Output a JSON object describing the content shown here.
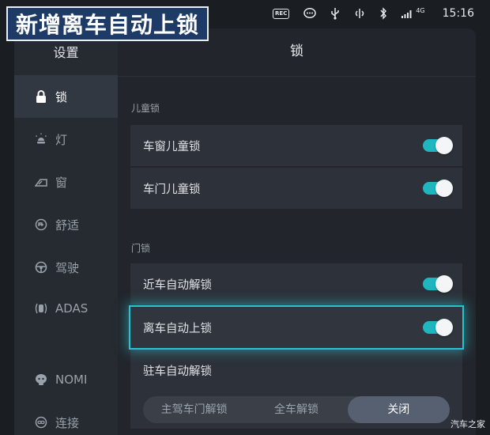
{
  "caption": "新增离车自动上锁",
  "status_bar": {
    "rec_label": "REC",
    "network": "4G",
    "time": "15:16"
  },
  "sidebar": {
    "title": "设置",
    "items": [
      {
        "label": "锁",
        "icon": "lock-icon",
        "active": true
      },
      {
        "label": "灯",
        "icon": "light-icon",
        "active": false
      },
      {
        "label": "窗",
        "icon": "window-icon",
        "active": false
      },
      {
        "label": "舒适",
        "icon": "comfort-icon",
        "active": false
      },
      {
        "label": "驾驶",
        "icon": "steering-wheel-icon",
        "active": false
      },
      {
        "label": "ADAS",
        "icon": "adas-icon",
        "active": false
      },
      {
        "label": "NOMI",
        "icon": "nomi-icon",
        "active": false
      },
      {
        "label": "连接",
        "icon": "link-icon",
        "active": false
      }
    ]
  },
  "content": {
    "title": "锁",
    "child_lock_section": "儿童锁",
    "window_child_lock": {
      "label": "车窗儿童锁",
      "enabled": true
    },
    "door_child_lock": {
      "label": "车门儿童锁",
      "enabled": true
    },
    "door_lock_section": "门锁",
    "approach_unlock": {
      "label": "近车自动解锁",
      "enabled": true
    },
    "leave_lock": {
      "label": "离车自动上锁",
      "enabled": true
    },
    "park_unlock": {
      "label": "驻车自动解锁",
      "options": [
        "主驾车门解锁",
        "全车解锁",
        "关闭"
      ],
      "selected": "关闭"
    }
  },
  "watermark": "汽车之家",
  "colors": {
    "accent": "#1fb7bf",
    "highlight_glow": "#29c3cf",
    "caption_bg": "#1e3a66"
  }
}
